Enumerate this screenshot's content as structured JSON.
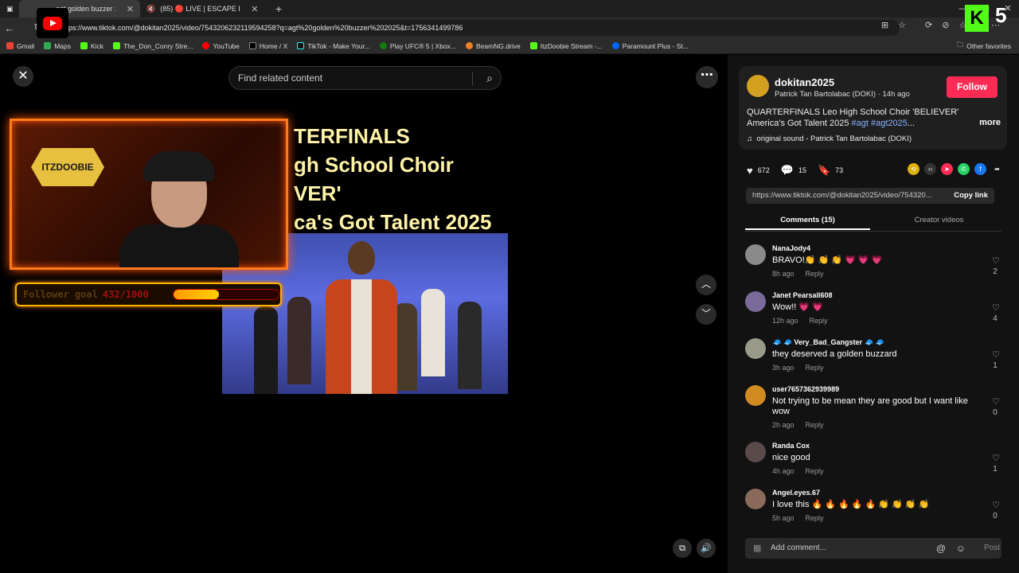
{
  "browser": {
    "tabs": [
      {
        "label": "agt golden buzzer 202…",
        "active": true
      },
      {
        "label": "(85) 🔴 LIVE | ESCAPE FROM…",
        "active": false
      }
    ],
    "url": "https://www.tiktok.com/@dokitan2025/video/7543206232119594258?q=agt%20golden%20buzzer%202025&t=1756341499786",
    "url_display": "ps://www.tiktok.com/@dokitan2025/video/7543206232119594258?q=agt%20golden%20buzzer%202025&t=1756341499786",
    "bookmarks": [
      "Gmail",
      "Maps",
      "Kick",
      "The_Don_Conry Stre...",
      "YouTube",
      "Home / X",
      "TikTok - Make Your...",
      "Play UFC® 5 | Xbox...",
      "BeamNG.drive",
      "ItzDoobie Stream -...",
      "Paramount Plus - St..."
    ],
    "other_favorites": "Other favorites",
    "overlay_number": "5"
  },
  "page": {
    "search_placeholder": "Find related content",
    "video_title_lines": [
      "TERFINALS",
      "gh School Choir",
      "VER'",
      "ca's Got Talent 2025"
    ],
    "overlay": {
      "logo_text": "ITZDOOBIE",
      "goal_label": "Follower goal",
      "goal_numbers": "432/1000",
      "goal_progress": 0.43
    }
  },
  "author": {
    "handle": "dokitan2025",
    "subtitle": "Patrick Tan Bartolabac (DOKI) · 14h ago",
    "follow_label": "Follow",
    "description_prefix": "QUARTERFINALS Leo High School Choir 'BELIEVER' America's Got Talent 2025 ",
    "tag1": "#agt",
    "tag2": "#agt2025",
    "ellipsis": "...",
    "more_label": "more",
    "sound": "original sound - Patrick Tan Bartolabac (DOKI)"
  },
  "stats": {
    "likes": "672",
    "comments": "15",
    "saves": "73"
  },
  "link": {
    "url": "https://www.tiktok.com/@dokitan2025/video/754320...",
    "copy_label": "Copy link"
  },
  "tabs": {
    "comments": "Comments (15)",
    "creator": "Creator videos"
  },
  "comments": [
    {
      "name": "NanaJody4",
      "text": "BRAVO!👏 👏 👏 💗 💗 💗",
      "time": "8h ago",
      "likes": "2",
      "color": "#8a8a8a"
    },
    {
      "name": "Janet Pearsall608",
      "text": "Wow!! 💗 💗",
      "time": "12h ago",
      "likes": "4",
      "color": "#7a6a9a"
    },
    {
      "name": "🧢 🧢 Very_Bad_Gangster 🧢 🧢",
      "text": "they deserved a golden buzzard",
      "time": "3h ago",
      "likes": "1",
      "color": "#9a9a8a"
    },
    {
      "name": "user7657362939989",
      "text": "Not trying to be mean they are good but I want like wow",
      "time": "2h ago",
      "likes": "0",
      "color": "#d08a20"
    },
    {
      "name": "Randa Cox",
      "text": "nice good",
      "time": "4h ago",
      "likes": "1",
      "color": "#5a4a4a"
    },
    {
      "name": "Angel.eyes.67",
      "text": "I love this 🔥 🔥 🔥 🔥 🔥 👏 👏 👏 👏",
      "time": "5h ago",
      "likes": "0",
      "color": "#8a6a5a"
    }
  ],
  "reply_label": "Reply",
  "add_comment": {
    "placeholder": "Add comment...",
    "post_label": "Post"
  },
  "colors": {
    "follow": "#fe2c55",
    "tag": "#8ab4ff",
    "overlay_border": "#ff7a1a",
    "goal_fill": "#ffd000"
  },
  "icons": [
    "close-icon",
    "search-icon",
    "more-icon",
    "chevron-up-icon",
    "chevron-down-icon",
    "heart-icon",
    "comment-icon",
    "bookmark-icon",
    "music-icon",
    "picture-icon",
    "at-icon",
    "emoji-icon",
    "volume-icon",
    "pip-icon"
  ]
}
